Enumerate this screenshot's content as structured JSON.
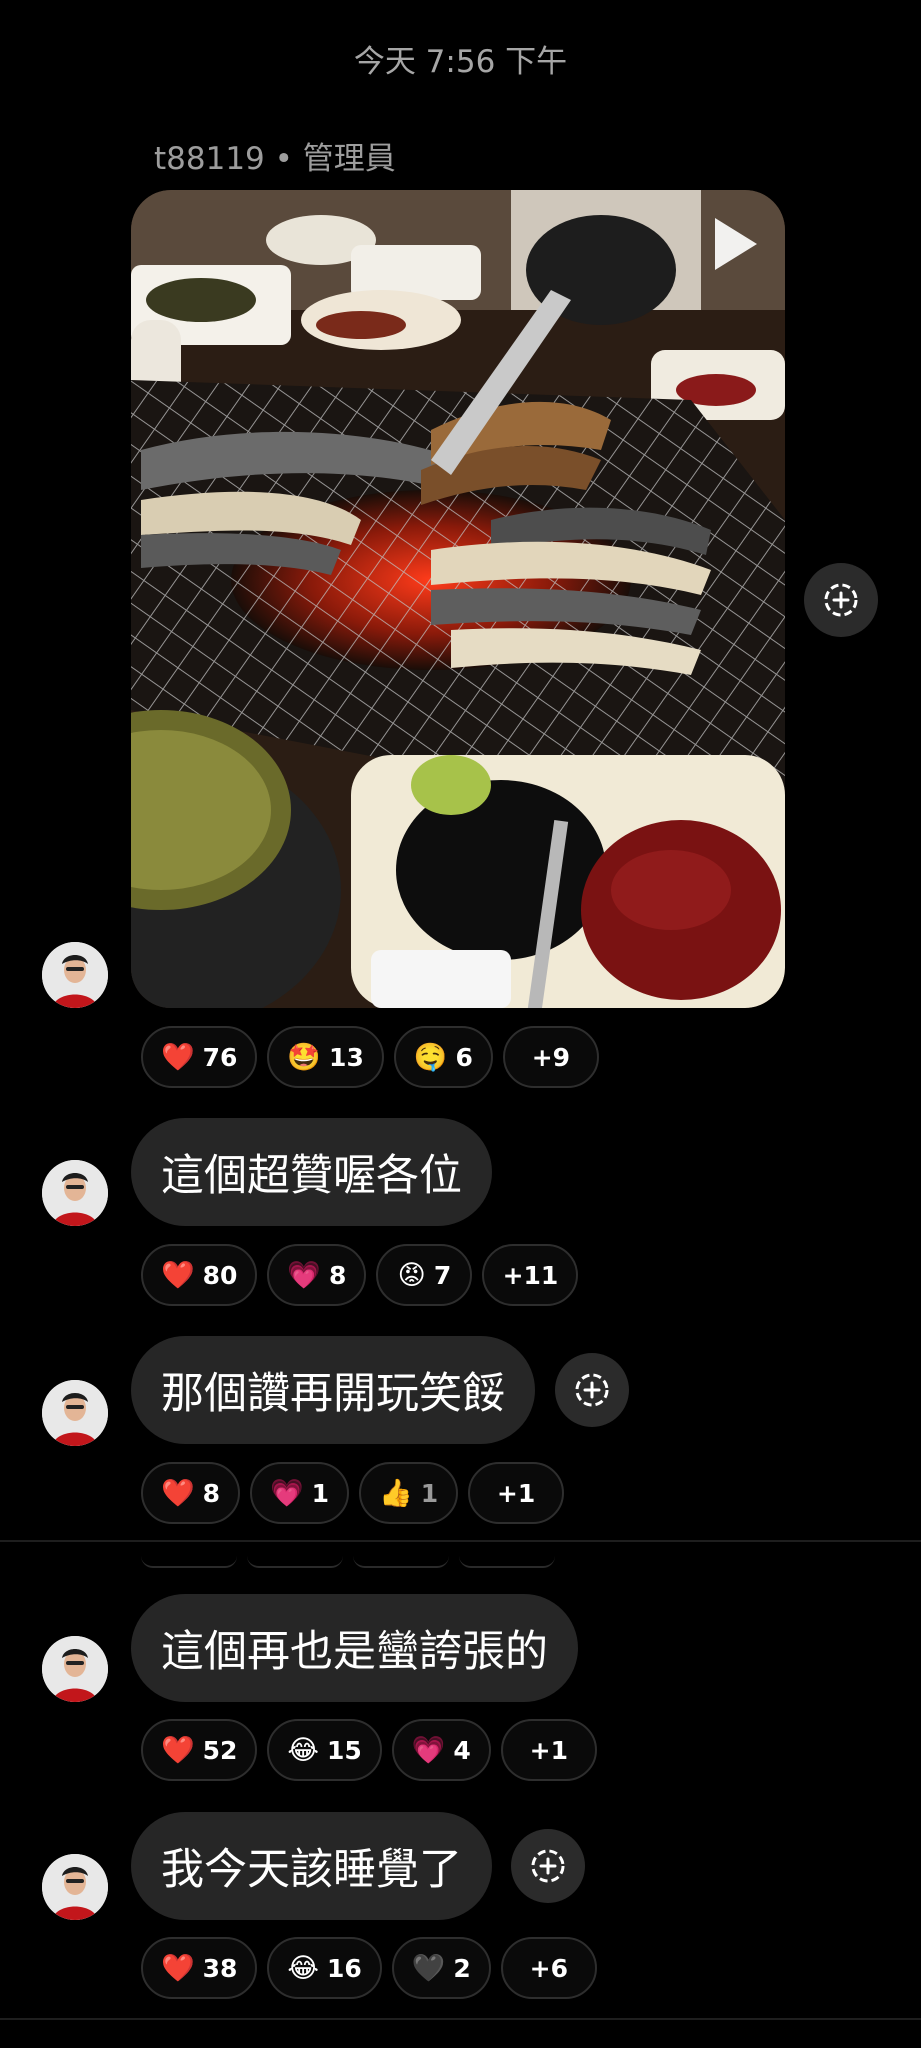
{
  "header": {
    "timestamp": "今天 7:56 下午"
  },
  "media_message": {
    "sender_label": "t88119 • 管理員",
    "reactions": [
      {
        "emoji": "❤️",
        "count": "76"
      },
      {
        "emoji": "🤩",
        "count": "13"
      },
      {
        "emoji": "🤤",
        "count": "6"
      },
      {
        "emoji": "",
        "count": "+9"
      }
    ]
  },
  "messages": [
    {
      "text": "這個超贊喔各位",
      "reactions": [
        {
          "emoji": "❤️",
          "count": "80"
        },
        {
          "emoji": "💗",
          "count": "8"
        },
        {
          "emoji": "😡",
          "count": "7"
        },
        {
          "emoji": "",
          "count": "+11"
        }
      ]
    },
    {
      "text": "那個讚再開玩笑餒",
      "reactions": [
        {
          "emoji": "❤️",
          "count": "8"
        },
        {
          "emoji": "💗",
          "count": "1"
        },
        {
          "emoji": "👍",
          "count": "1"
        },
        {
          "emoji": "",
          "count": "+1"
        }
      ]
    },
    {
      "text": "這個再也是蠻誇張的",
      "reactions": [
        {
          "emoji": "❤️",
          "count": "52"
        },
        {
          "emoji": "😂",
          "count": "15"
        },
        {
          "emoji": "💗",
          "count": "4"
        },
        {
          "emoji": "",
          "count": "+1"
        }
      ]
    },
    {
      "text": "我今天該睡覺了",
      "reactions": [
        {
          "emoji": "❤️",
          "count": "38"
        },
        {
          "emoji": "😂",
          "count": "16"
        },
        {
          "emoji": "🖤",
          "count": "2"
        },
        {
          "emoji": "",
          "count": "+6"
        }
      ]
    }
  ],
  "icons": {
    "play": "play-icon",
    "add_reaction": "add-reaction-icon",
    "avatar": "user-avatar"
  },
  "colors": {
    "background": "#000000",
    "bubble": "#262626",
    "pill_border": "#2e2e2e",
    "muted_text": "#a6a6a6"
  }
}
